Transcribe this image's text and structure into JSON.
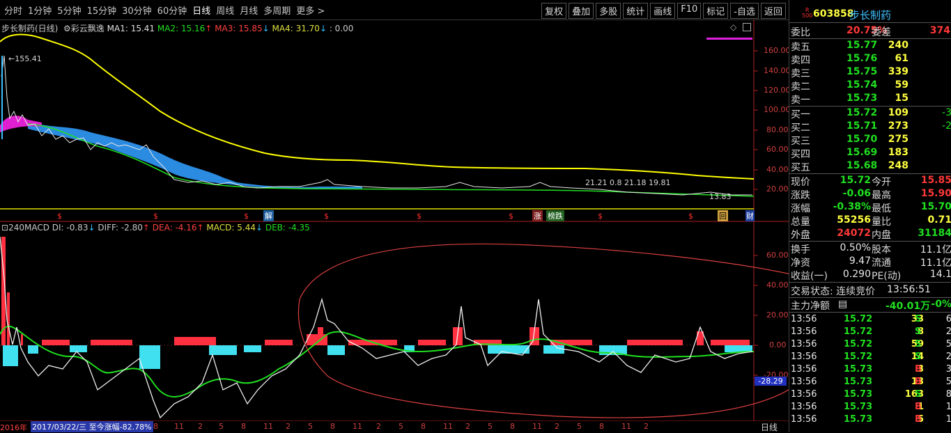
{
  "toolbar": {
    "periods": [
      "分时",
      "1分钟",
      "5分钟",
      "15分钟",
      "30分钟",
      "60分钟",
      "日线",
      "周线",
      "月线",
      "多周期",
      "更多 >"
    ],
    "active_period": "日线",
    "actions": [
      "复权",
      "叠加",
      "多股",
      "统计",
      "画线",
      "F10",
      "标记",
      "-自选",
      "返回"
    ]
  },
  "kline": {
    "stock_label": "步长制药(日线)",
    "indicator": "彩云飘逸",
    "ma1": "MA1: 15.41",
    "ma2": "MA2: 15.16",
    "ma3": "MA3: 15.85",
    "ma4": "MA4: 31.70",
    "tail": ": 0.00",
    "high_label": "155.41",
    "low_label": "13.83",
    "mid_label": "21.21 0.8 21.18 19.81",
    "yticks": [
      "160.00",
      "140.00",
      "120.00",
      "100.00",
      "80.00",
      "60.00",
      "40.00",
      "20.00"
    ],
    "markers": [
      "$",
      "$",
      "$",
      "解",
      "$",
      "$",
      "$",
      "$",
      "涨",
      "榜跌",
      "$",
      "$",
      "$",
      "回",
      "财"
    ]
  },
  "macd": {
    "title": "240MACD",
    "di": "DI: -0.83",
    "diff": "DIFF: -2.80",
    "dea": "DEA: -4.16",
    "macd": "MACD: 5.44",
    "deb": "DEB: -4.35",
    "yticks": [
      "60.00",
      "40.00",
      "20.00",
      "0.00",
      "-20.00"
    ],
    "current": "-28.29"
  },
  "bottom": {
    "year": "2016年",
    "date_info": "2017/03/22/三 至今涨幅-82.78%",
    "months": [
      "8",
      "11",
      "2",
      "5",
      "8",
      "11",
      "2",
      "5",
      "8",
      "11",
      "2",
      "5",
      "8",
      "11",
      "2",
      "5",
      "8",
      "11",
      "2",
      "5",
      "8",
      "11",
      "2"
    ],
    "period_label": "日线"
  },
  "quote": {
    "logo_top": "R",
    "logo_bot": "500",
    "code": "603858",
    "name": "步长制药",
    "weibi_label": "委比",
    "weibi": "20.75%",
    "weicha_label": "委差",
    "weicha": "374",
    "asks": [
      {
        "label": "卖五",
        "price": "15.77",
        "vol": "240"
      },
      {
        "label": "卖四",
        "price": "15.76",
        "vol": "61"
      },
      {
        "label": "卖三",
        "price": "15.75",
        "vol": "339"
      },
      {
        "label": "卖二",
        "price": "15.74",
        "vol": "59"
      },
      {
        "label": "卖一",
        "price": "15.73",
        "vol": "15"
      }
    ],
    "bids": [
      {
        "label": "买一",
        "price": "15.72",
        "vol": "109",
        "chg": "-3"
      },
      {
        "label": "买二",
        "price": "15.71",
        "vol": "273",
        "chg": "-2"
      },
      {
        "label": "买三",
        "price": "15.70",
        "vol": "275",
        "chg": ""
      },
      {
        "label": "买四",
        "price": "15.69",
        "vol": "183",
        "chg": ""
      },
      {
        "label": "买五",
        "price": "15.68",
        "vol": "248",
        "chg": ""
      }
    ],
    "stats": [
      {
        "l1": "现价",
        "v1": "15.72",
        "l2": "今开",
        "v2": "15.85"
      },
      {
        "l1": "涨跌",
        "v1": "-0.06",
        "l2": "最高",
        "v2": "15.90"
      },
      {
        "l1": "涨幅",
        "v1": "-0.38%",
        "l2": "最低",
        "v2": "15.70"
      },
      {
        "l1": "总量",
        "v1": "55256",
        "l2": "量比",
        "v2": "0.71"
      },
      {
        "l1": "外盘",
        "v1": "24072",
        "l2": "内盘",
        "v2": "31184"
      }
    ],
    "fin": [
      {
        "l1": "换手",
        "v1": "0.50%",
        "l2": "股本",
        "v2": "11.1亿"
      },
      {
        "l1": "净资",
        "v1": "9.47",
        "l2": "流通",
        "v2": "11.1亿"
      },
      {
        "l1": "收益(一)",
        "v1": "0.290",
        "l2": "PE(动)",
        "v2": "14.1"
      }
    ],
    "trade_state": "交易状态: 连续竞价",
    "trade_time": "13:56:51",
    "main_flow_label": "主力净额",
    "main_flow": "-40.01万",
    "main_flow_pct": "-0%",
    "ticks": [
      {
        "t": "13:56",
        "p": "15.72",
        "v": "33",
        "d": "S",
        "n": "6"
      },
      {
        "t": "13:56",
        "p": "15.72",
        "v": "8",
        "d": "S",
        "n": "2"
      },
      {
        "t": "13:56",
        "p": "15.72",
        "v": "59",
        "d": "S",
        "n": "5"
      },
      {
        "t": "13:56",
        "p": "15.72",
        "v": "14",
        "d": "S",
        "n": "2"
      },
      {
        "t": "13:56",
        "p": "15.73",
        "v": "3",
        "d": "B",
        "n": "3"
      },
      {
        "t": "13:56",
        "p": "15.73",
        "v": "13",
        "d": "B",
        "n": "5"
      },
      {
        "t": "13:56",
        "p": "15.73",
        "v": "163",
        "d": "S",
        "n": "8"
      },
      {
        "t": "13:56",
        "p": "15.73",
        "v": "1",
        "d": "B",
        "n": "1"
      },
      {
        "t": "13:56",
        "p": "15.73",
        "v": "5",
        "d": "B",
        "n": "1"
      }
    ]
  }
}
